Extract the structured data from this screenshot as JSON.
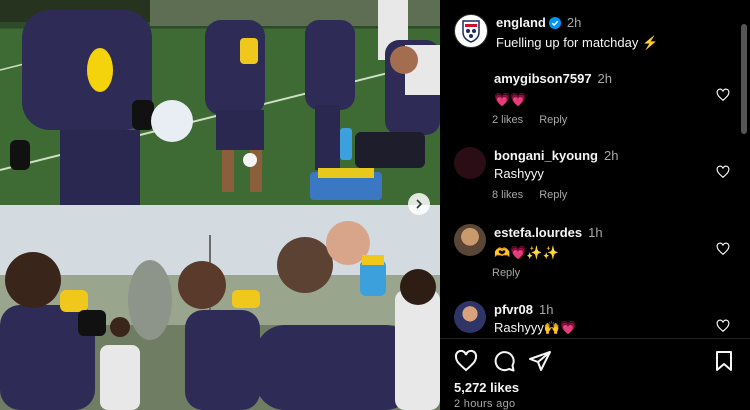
{
  "post": {
    "username": "england",
    "time": "2h",
    "caption": "Fuelling up for matchday",
    "caption_emoji": "⚡"
  },
  "comments": [
    {
      "username": "amygibson7597",
      "time": "2h",
      "text": "💗💗",
      "likes": "2 likes",
      "reply": "Reply",
      "avatar_color": "#000000"
    },
    {
      "username": "bongani_kyoung",
      "time": "2h",
      "text": "Rashyyy",
      "likes": "8 likes",
      "reply": "Reply",
      "avatar_color": "#2a0d15"
    },
    {
      "username": "estefa.lourdes",
      "time": "1h",
      "text": "🫶💗✨✨",
      "likes": "",
      "reply": "Reply",
      "avatar_color": "#6b5a49"
    },
    {
      "username": "pfvr08",
      "time": "1h",
      "text": "Rashyyy🙌💗",
      "likes": "",
      "reply": "",
      "avatar_color": "#3b3f66"
    }
  ],
  "stats": {
    "likes": "5,272 likes",
    "posted": "2 hours ago"
  },
  "colors": {
    "verified": "#0095f6",
    "text": "#f5f5f5",
    "secondary": "#a8a8a8",
    "bg": "#000000"
  }
}
